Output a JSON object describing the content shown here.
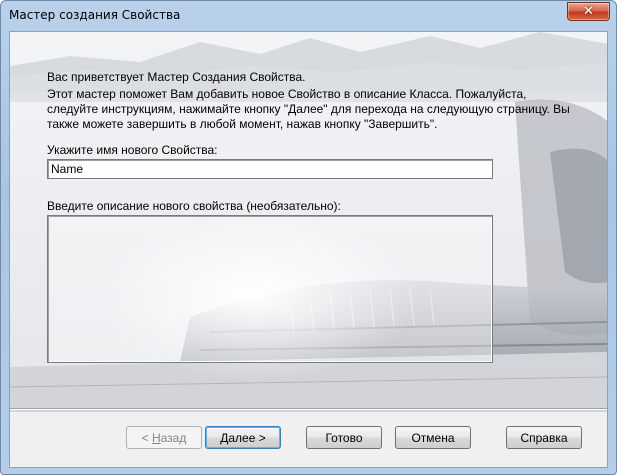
{
  "window": {
    "title": "Мастер создания Свойства",
    "close_glyph": "✕"
  },
  "wizard": {
    "welcome": "Вас приветствует Мастер Создания Свойства.",
    "description": "Этот мастер поможет Вам добавить новое Свойство в описание Класса. Пожалуйста, следуйте инструкциям, нажимайте кнопку \"Далее\" для перехода на следующую страницу.  Вы также можете завершить в любой момент, нажав кнопку \"Завершить\".",
    "name_label": "Укажите имя нового Свойства:",
    "name_value": "Name",
    "desc_label": "Введите описание нового свойства (необязательно):",
    "desc_value": ""
  },
  "buttons": {
    "back_prefix": "< ",
    "back_accel": "Н",
    "back_rest": "азад",
    "next_accel": "Д",
    "next_rest": "алее >",
    "finish": "Готово",
    "cancel": "Отмена",
    "help": "Справка"
  },
  "colors": {
    "title_bar": "#b9d1ea",
    "close_button": "#c94a30",
    "dialog_bg": "#f0f0f0",
    "default_button_focus": "#3c7fb1"
  }
}
